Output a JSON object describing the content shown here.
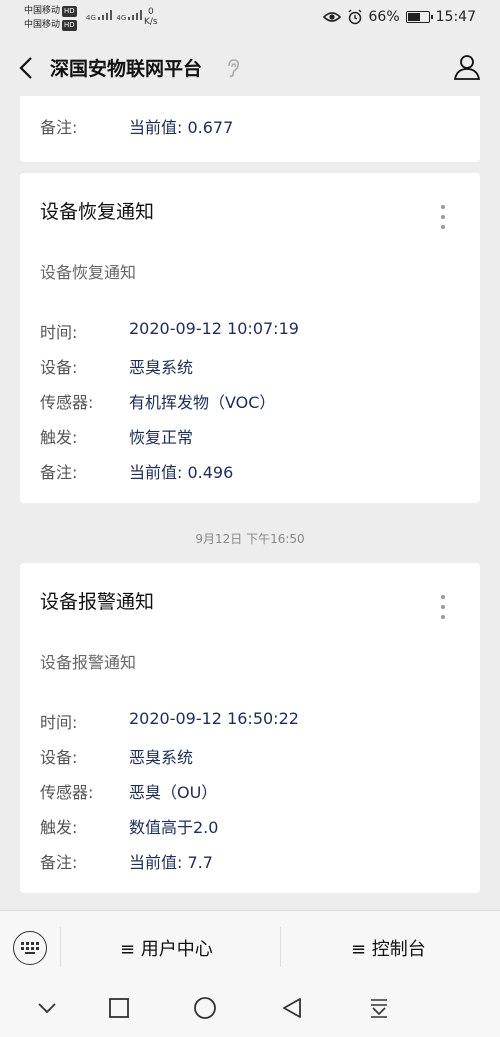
{
  "status": {
    "carrier1": "中国移动",
    "carrier2": "中国移动",
    "hd_badge": "HD",
    "network": "4G",
    "speed_value": "0",
    "speed_unit": "K/s",
    "battery": "66%",
    "battery_level": 0.66,
    "time": "15:47"
  },
  "nav": {
    "title": "深国安物联网平台"
  },
  "partial_card": {
    "note_label": "备注:",
    "note_value": "当前值:  0.677"
  },
  "card1": {
    "title": "设备恢复通知",
    "subtitle": "设备恢复通知",
    "rows": [
      {
        "label": "时间:",
        "value": "2020-09-12 10:07:19"
      },
      {
        "label": "设备:",
        "value": "恶臭系统"
      },
      {
        "label": "传感器:",
        "value": "有机挥发物（VOC）"
      },
      {
        "label": "触发:",
        "value": "恢复正常"
      },
      {
        "label": "备注:",
        "value": "当前值:  0.496"
      }
    ]
  },
  "divider": {
    "time": "9月12日 下午16:50"
  },
  "card2": {
    "title": "设备报警通知",
    "subtitle": "设备报警通知",
    "rows": [
      {
        "label": "时间:",
        "value": "2020-09-12 16:50:22"
      },
      {
        "label": "设备:",
        "value": "恶臭系统"
      },
      {
        "label": "传感器:",
        "value": "恶臭（OU）"
      },
      {
        "label": "触发:",
        "value": "数值高于2.0"
      },
      {
        "label": "备注:",
        "value": "当前值:  7.7"
      }
    ]
  },
  "menu": {
    "item1": "≡ 用户中心",
    "item2": "≡ 控制台"
  },
  "colors": {
    "background": "#ededed",
    "card": "#ffffff",
    "value_text": "#1c2d5c",
    "label_text": "#555555"
  }
}
